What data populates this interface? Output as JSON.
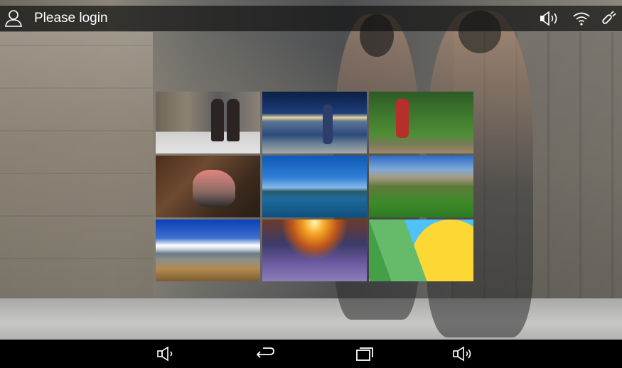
{
  "status_bar": {
    "login_text": "Please login",
    "icons": [
      "user-icon",
      "speaker-icon",
      "wifi-icon",
      "satellite-icon"
    ]
  },
  "tiles": [
    {
      "name": "runners-street",
      "icon": "image-thumbnail"
    },
    {
      "name": "runner-harbor",
      "icon": "image-thumbnail"
    },
    {
      "name": "runner-forest",
      "icon": "image-thumbnail"
    },
    {
      "name": "running-shoes",
      "icon": "image-thumbnail"
    },
    {
      "name": "lake-mountains",
      "icon": "image-thumbnail"
    },
    {
      "name": "green-hills",
      "icon": "image-thumbnail"
    },
    {
      "name": "mountain-lake-clouds",
      "icon": "image-thumbnail"
    },
    {
      "name": "sunrise-fisheye",
      "icon": "image-thumbnail"
    },
    {
      "name": "abstract-wallpaper",
      "icon": "image-thumbnail"
    }
  ],
  "nav_bar": {
    "icons": [
      "volume-down-icon",
      "back-icon",
      "recent-apps-icon",
      "volume-up-icon"
    ]
  },
  "colors": {
    "status_bar_bg": "#141414",
    "nav_bar_bg": "#000000",
    "text": "#ffffff"
  }
}
